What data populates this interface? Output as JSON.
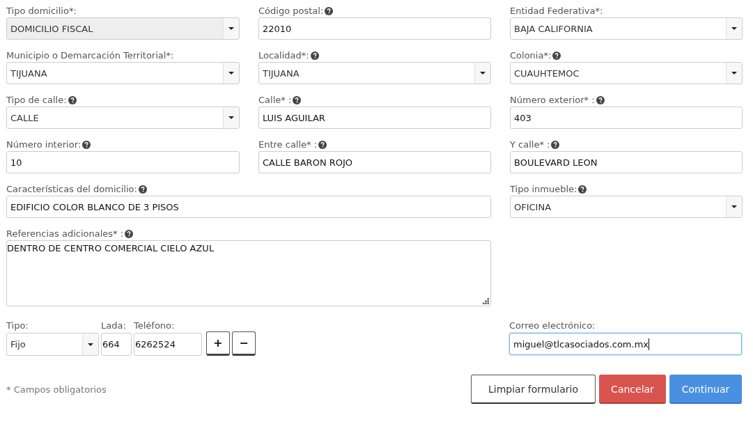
{
  "fields": [
    {
      "kind": "select",
      "label": "Tipo domicilio*:",
      "value": "DOMICILIO FISCAL",
      "help": false,
      "disabled": true,
      "wide": false
    },
    {
      "kind": "text",
      "label": "Código postal:",
      "value": "22010",
      "help": true,
      "disabled": false,
      "wide": false
    },
    {
      "kind": "select",
      "label": "Entidad Federativa*:",
      "value": "BAJA CALIFORNIA",
      "help": false,
      "disabled": false,
      "wide": false
    },
    {
      "kind": "select",
      "label": "Municipio o Demarcación Territorial*:",
      "value": "TIJUANA",
      "help": false,
      "disabled": false,
      "wide": false
    },
    {
      "kind": "select",
      "label": "Localidad*:",
      "value": "TIJUANA",
      "help": true,
      "disabled": false,
      "wide": false
    },
    {
      "kind": "select",
      "label": "Colonia*:",
      "value": "CUAUHTEMOC",
      "help": true,
      "disabled": false,
      "wide": false
    },
    {
      "kind": "select",
      "label": "Tipo de calle:",
      "value": "CALLE",
      "help": true,
      "disabled": false,
      "wide": false
    },
    {
      "kind": "text",
      "label": "Calle* :",
      "value": "LUIS AGUILAR",
      "help": true,
      "disabled": false,
      "wide": false
    },
    {
      "kind": "text",
      "label": "Número exterior* :",
      "value": "403",
      "help": true,
      "disabled": false,
      "wide": false
    },
    {
      "kind": "text",
      "label": "Número interior:",
      "value": "10",
      "help": true,
      "disabled": false,
      "wide": false
    },
    {
      "kind": "text",
      "label": "Entre calle* :",
      "value": "CALLE BARON ROJO",
      "help": true,
      "disabled": false,
      "wide": false
    },
    {
      "kind": "text",
      "label": "Y calle* :",
      "value": "BOULEVARD LEON",
      "help": true,
      "disabled": false,
      "wide": false
    },
    {
      "kind": "text",
      "label": "Características del domicilio:",
      "value": "EDIFICIO COLOR BLANCO DE 3 PISOS",
      "help": true,
      "disabled": false,
      "wide": true
    },
    {
      "kind": "select",
      "label": "Tipo inmueble:",
      "value": "OFICINA",
      "help": true,
      "disabled": false,
      "wide": false
    },
    {
      "kind": "textarea",
      "label": "Referencias adicionales* :",
      "value": "DENTRO DE CENTRO COMERCIAL CIELO AZUL",
      "help": true,
      "disabled": false,
      "wide": true
    }
  ],
  "phone": {
    "type_label": "Tipo:",
    "type_value": "Fijo",
    "lada_label": "Lada:",
    "lada_value": "664",
    "phone_label": "Teléfono:",
    "phone_value": "6262524",
    "add": "+",
    "remove": "−"
  },
  "email": {
    "label": "Correo electrónico:",
    "value": "miguel@tlcasociados.com.mx",
    "focused": true
  },
  "note": "* Campos obligatorios",
  "buttons": [
    {
      "kind": "default",
      "label": "Limpiar formulario"
    },
    {
      "kind": "danger",
      "label": "Cancelar"
    },
    {
      "kind": "primary",
      "label": "Continuar"
    }
  ]
}
